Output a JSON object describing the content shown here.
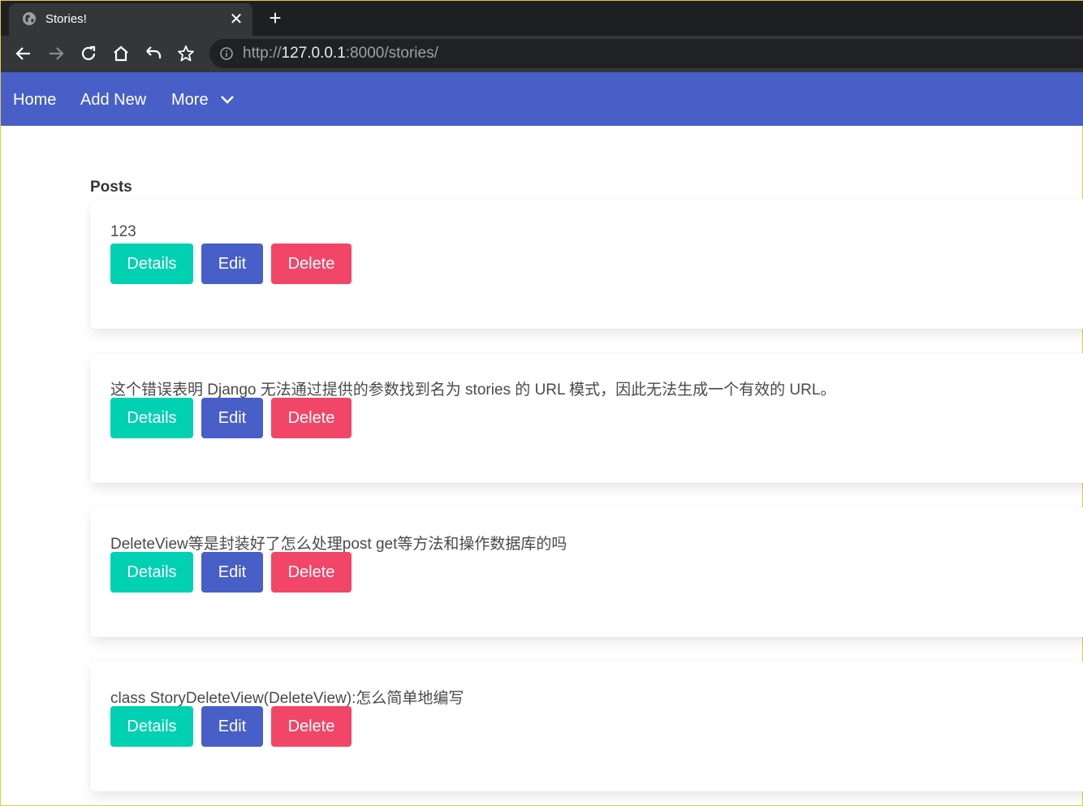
{
  "browser": {
    "tab_title": "Stories!",
    "tab_close": "✕",
    "new_tab": "+",
    "url_scheme": "http://",
    "url_host": "127.0.0.1",
    "url_rest": ":8000/stories/"
  },
  "nav": {
    "home": "Home",
    "add_new": "Add New",
    "more": "More"
  },
  "page": {
    "section_title": "Posts"
  },
  "posts": [
    {
      "text": "123",
      "details": "Details",
      "edit": "Edit",
      "delete": "Delete"
    },
    {
      "text": "这个错误表明 Django 无法通过提供的参数找到名为 stories 的 URL 模式，因此无法生成一个有效的 URL。",
      "details": "Details",
      "edit": "Edit",
      "delete": "Delete"
    },
    {
      "text": "DeleteView等是封装好了怎么处理post get等方法和操作数据库的吗",
      "details": "Details",
      "edit": "Edit",
      "delete": "Delete"
    },
    {
      "text": "class StoryDeleteView(DeleteView):怎么简单地编写",
      "details": "Details",
      "edit": "Edit",
      "delete": "Delete"
    }
  ],
  "colors": {
    "navbar": "#485fc7",
    "details_button": "#00d1b2",
    "edit_button": "#485fc7",
    "delete_button": "#f14668"
  }
}
